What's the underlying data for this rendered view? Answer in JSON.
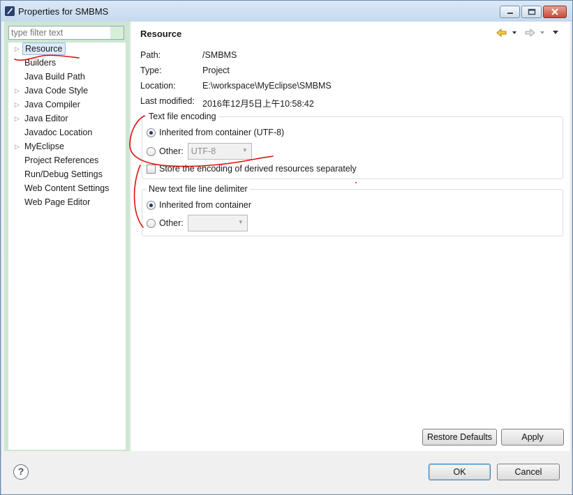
{
  "window": {
    "title": "Properties for SMBMS",
    "controls": {
      "minimize_icon": "minimize-icon",
      "maximize_icon": "maximize-icon",
      "close_icon": "close-icon"
    }
  },
  "filter": {
    "placeholder": "type filter text"
  },
  "tree": {
    "items": [
      {
        "label": "Resource",
        "expandable": true,
        "selected": true
      },
      {
        "label": "Builders",
        "expandable": false
      },
      {
        "label": "Java Build Path",
        "expandable": false
      },
      {
        "label": "Java Code Style",
        "expandable": true
      },
      {
        "label": "Java Compiler",
        "expandable": true
      },
      {
        "label": "Java Editor",
        "expandable": true
      },
      {
        "label": "Javadoc Location",
        "expandable": false
      },
      {
        "label": "MyEclipse",
        "expandable": true
      },
      {
        "label": "Project References",
        "expandable": false
      },
      {
        "label": "Run/Debug Settings",
        "expandable": false
      },
      {
        "label": "Web Content Settings",
        "expandable": false
      },
      {
        "label": "Web Page Editor",
        "expandable": false
      }
    ]
  },
  "page": {
    "title": "Resource",
    "properties": [
      {
        "label": "Path:",
        "value": "/SMBMS"
      },
      {
        "label": "Type:",
        "value": "Project"
      },
      {
        "label": "Location:",
        "value": "E:\\workspace\\MyEclipse\\SMBMS"
      },
      {
        "label": "Last modified:",
        "value": "2016年12月5日上午10:58:42"
      }
    ],
    "encoding": {
      "title": "Text file encoding",
      "inherited_label": "Inherited from container (UTF-8)",
      "other_label": "Other:",
      "other_value": "UTF-8",
      "derived_label": "Store the encoding of derived resources separately",
      "selected": "inherited"
    },
    "delimiter": {
      "title": "New text file line delimiter",
      "inherited_label": "Inherited from container",
      "other_label": "Other:",
      "other_value": "",
      "selected": "inherited"
    }
  },
  "buttons": {
    "restore_defaults": "Restore Defaults",
    "apply": "Apply",
    "ok": "OK",
    "cancel": "Cancel",
    "help": "?"
  },
  "colors": {
    "annotation_ink": "#e01010",
    "tree_background_accent": "#cde7d1"
  }
}
